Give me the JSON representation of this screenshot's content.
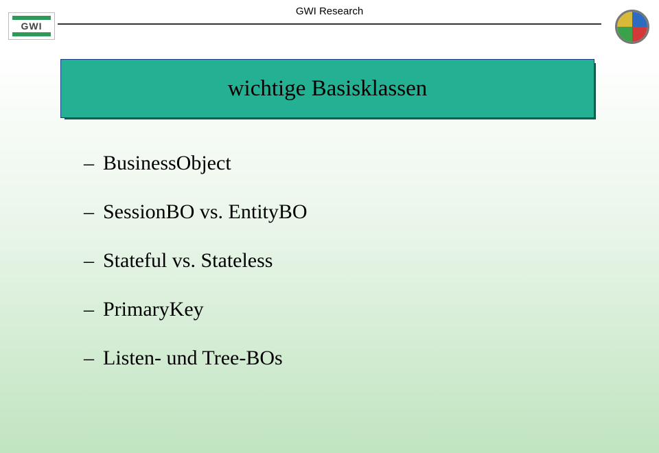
{
  "header": {
    "brandText": "GWI",
    "title": "GWI Research"
  },
  "titleBox": {
    "text": "wichtige Basisklassen"
  },
  "content": {
    "items": [
      "BusinessObject",
      "SessionBO vs. EntityBO",
      "Stateful vs. Stateless",
      "PrimaryKey",
      "Listen- und Tree-BOs"
    ]
  }
}
